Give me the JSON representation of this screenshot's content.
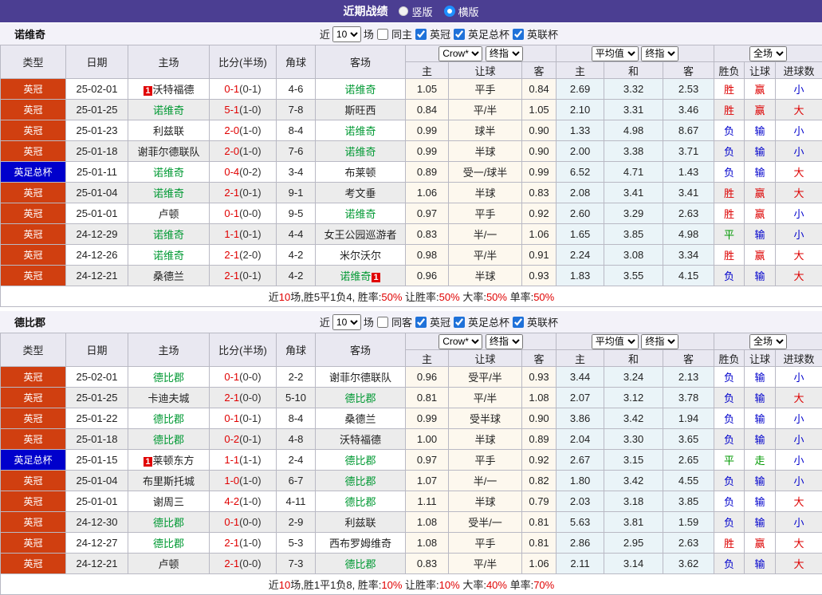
{
  "top_bar": {
    "title": "近期战绩",
    "radios": [
      {
        "label": "竖版",
        "selected": false
      },
      {
        "label": "横版",
        "selected": true
      }
    ]
  },
  "colors": {
    "topbar_purple": "#4b3e92",
    "league_orange": "#d03f10",
    "league_blue": "#0000cc",
    "win_red": "#dd0000",
    "lose_blue": "#0000cc",
    "draw_green": "#009900",
    "focal_team_green": "#009933",
    "score_red": "#e00000",
    "summary_red": "#e00000"
  },
  "columns": [
    "类型",
    "日期",
    "主场",
    "比分(半场)",
    "角球",
    "客场",
    "主",
    "让球",
    "客",
    "主",
    "和",
    "客",
    "胜负",
    "让球",
    "进球数"
  ],
  "selects": {
    "bookmaker": "Crow*",
    "stage1": "终指",
    "average": "平均值",
    "stage2": "终指",
    "scope": "全场"
  },
  "sections": [
    {
      "team": "诺维奇",
      "controls": {
        "recent_label": "近",
        "count": "10",
        "unit_label": "场",
        "same_venue_label": "同主",
        "same_venue_checked": false,
        "leagues": [
          {
            "label": "英冠",
            "checked": true
          },
          {
            "label": "英足总杯",
            "checked": true
          },
          {
            "label": "英联杯",
            "checked": true
          }
        ]
      },
      "rows": [
        {
          "league": "英冠",
          "league_color": "orange",
          "date": "25-02-01",
          "home": "沃特福德",
          "home_focal": false,
          "home_badge": "1",
          "home_badge_pos": "before",
          "away": "诺维奇",
          "away_focal": true,
          "away_badge": "",
          "away_badge_pos": "",
          "score": "0-1",
          "half": "(0-1)",
          "corner": "4-6",
          "ah": [
            "1.05",
            "平手",
            "0.84"
          ],
          "eu": [
            "2.69",
            "3.32",
            "2.53"
          ],
          "res": [
            [
              "胜",
              "r"
            ],
            [
              "赢",
              "r"
            ],
            [
              "小",
              "b"
            ]
          ]
        },
        {
          "league": "英冠",
          "league_color": "orange",
          "date": "25-01-25",
          "home": "诺维奇",
          "home_focal": true,
          "home_badge": "",
          "home_badge_pos": "",
          "away": "斯旺西",
          "away_focal": false,
          "away_badge": "",
          "away_badge_pos": "",
          "score": "5-1",
          "half": "(1-0)",
          "corner": "7-8",
          "ah": [
            "0.84",
            "平/半",
            "1.05"
          ],
          "eu": [
            "2.10",
            "3.31",
            "3.46"
          ],
          "res": [
            [
              "胜",
              "r"
            ],
            [
              "赢",
              "r"
            ],
            [
              "大",
              "r"
            ]
          ]
        },
        {
          "league": "英冠",
          "league_color": "orange",
          "date": "25-01-23",
          "home": "利兹联",
          "home_focal": false,
          "home_badge": "",
          "home_badge_pos": "",
          "away": "诺维奇",
          "away_focal": true,
          "away_badge": "",
          "away_badge_pos": "",
          "score": "2-0",
          "half": "(1-0)",
          "corner": "8-4",
          "ah": [
            "0.99",
            "球半",
            "0.90"
          ],
          "eu": [
            "1.33",
            "4.98",
            "8.67"
          ],
          "res": [
            [
              "负",
              "b"
            ],
            [
              "输",
              "b"
            ],
            [
              "小",
              "b"
            ]
          ]
        },
        {
          "league": "英冠",
          "league_color": "orange",
          "date": "25-01-18",
          "home": "谢菲尔德联队",
          "home_focal": false,
          "home_badge": "",
          "home_badge_pos": "",
          "away": "诺维奇",
          "away_focal": true,
          "away_badge": "",
          "away_badge_pos": "",
          "score": "2-0",
          "half": "(1-0)",
          "corner": "7-6",
          "ah": [
            "0.99",
            "半球",
            "0.90"
          ],
          "eu": [
            "2.00",
            "3.38",
            "3.71"
          ],
          "res": [
            [
              "负",
              "b"
            ],
            [
              "输",
              "b"
            ],
            [
              "小",
              "b"
            ]
          ]
        },
        {
          "league": "英足总杯",
          "league_color": "blue",
          "date": "25-01-11",
          "home": "诺维奇",
          "home_focal": true,
          "home_badge": "",
          "home_badge_pos": "",
          "away": "布莱顿",
          "away_focal": false,
          "away_badge": "",
          "away_badge_pos": "",
          "score": "0-4",
          "half": "(0-2)",
          "corner": "3-4",
          "ah": [
            "0.89",
            "受一/球半",
            "0.99"
          ],
          "eu": [
            "6.52",
            "4.71",
            "1.43"
          ],
          "res": [
            [
              "负",
              "b"
            ],
            [
              "输",
              "b"
            ],
            [
              "大",
              "r"
            ]
          ]
        },
        {
          "league": "英冠",
          "league_color": "orange",
          "date": "25-01-04",
          "home": "诺维奇",
          "home_focal": true,
          "home_badge": "",
          "home_badge_pos": "",
          "away": "考文垂",
          "away_focal": false,
          "away_badge": "",
          "away_badge_pos": "",
          "score": "2-1",
          "half": "(0-1)",
          "corner": "9-1",
          "ah": [
            "1.06",
            "半球",
            "0.83"
          ],
          "eu": [
            "2.08",
            "3.41",
            "3.41"
          ],
          "res": [
            [
              "胜",
              "r"
            ],
            [
              "赢",
              "r"
            ],
            [
              "大",
              "r"
            ]
          ]
        },
        {
          "league": "英冠",
          "league_color": "orange",
          "date": "25-01-01",
          "home": "卢顿",
          "home_focal": false,
          "home_badge": "",
          "home_badge_pos": "",
          "away": "诺维奇",
          "away_focal": true,
          "away_badge": "",
          "away_badge_pos": "",
          "score": "0-1",
          "half": "(0-0)",
          "corner": "9-5",
          "ah": [
            "0.97",
            "平手",
            "0.92"
          ],
          "eu": [
            "2.60",
            "3.29",
            "2.63"
          ],
          "res": [
            [
              "胜",
              "r"
            ],
            [
              "赢",
              "r"
            ],
            [
              "小",
              "b"
            ]
          ]
        },
        {
          "league": "英冠",
          "league_color": "orange",
          "date": "24-12-29",
          "home": "诺维奇",
          "home_focal": true,
          "home_badge": "",
          "home_badge_pos": "",
          "away": "女王公园巡游者",
          "away_focal": false,
          "away_badge": "",
          "away_badge_pos": "",
          "score": "1-1",
          "half": "(0-1)",
          "corner": "4-4",
          "ah": [
            "0.83",
            "半/一",
            "1.06"
          ],
          "eu": [
            "1.65",
            "3.85",
            "4.98"
          ],
          "res": [
            [
              "平",
              "g"
            ],
            [
              "输",
              "b"
            ],
            [
              "小",
              "b"
            ]
          ]
        },
        {
          "league": "英冠",
          "league_color": "orange",
          "date": "24-12-26",
          "home": "诺维奇",
          "home_focal": true,
          "home_badge": "",
          "home_badge_pos": "",
          "away": "米尔沃尔",
          "away_focal": false,
          "away_badge": "",
          "away_badge_pos": "",
          "score": "2-1",
          "half": "(2-0)",
          "corner": "4-2",
          "ah": [
            "0.98",
            "平/半",
            "0.91"
          ],
          "eu": [
            "2.24",
            "3.08",
            "3.34"
          ],
          "res": [
            [
              "胜",
              "r"
            ],
            [
              "赢",
              "r"
            ],
            [
              "大",
              "r"
            ]
          ]
        },
        {
          "league": "英冠",
          "league_color": "orange",
          "date": "24-12-21",
          "home": "桑德兰",
          "home_focal": false,
          "home_badge": "",
          "home_badge_pos": "",
          "away": "诺维奇",
          "away_focal": true,
          "away_badge": "1",
          "away_badge_pos": "after",
          "score": "2-1",
          "half": "(0-1)",
          "corner": "4-2",
          "ah": [
            "0.96",
            "半球",
            "0.93"
          ],
          "eu": [
            "1.83",
            "3.55",
            "4.15"
          ],
          "res": [
            [
              "负",
              "b"
            ],
            [
              "输",
              "b"
            ],
            [
              "大",
              "r"
            ]
          ]
        }
      ],
      "summary": [
        {
          "text": "近",
          "color": "dark"
        },
        {
          "text": "10",
          "color": "red"
        },
        {
          "text": "场,胜5平1负4, 胜率:",
          "color": "dark"
        },
        {
          "text": "50%",
          "color": "red"
        },
        {
          "text": " 让胜率:",
          "color": "dark"
        },
        {
          "text": "50%",
          "color": "red"
        },
        {
          "text": " 大率:",
          "color": "dark"
        },
        {
          "text": "50%",
          "color": "red"
        },
        {
          "text": " 单率:",
          "color": "dark"
        },
        {
          "text": "50%",
          "color": "red"
        }
      ]
    },
    {
      "team": "德比郡",
      "controls": {
        "recent_label": "近",
        "count": "10",
        "unit_label": "场",
        "same_venue_label": "同客",
        "same_venue_checked": false,
        "leagues": [
          {
            "label": "英冠",
            "checked": true
          },
          {
            "label": "英足总杯",
            "checked": true
          },
          {
            "label": "英联杯",
            "checked": true
          }
        ]
      },
      "rows": [
        {
          "league": "英冠",
          "league_color": "orange",
          "date": "25-02-01",
          "home": "德比郡",
          "home_focal": true,
          "home_badge": "",
          "home_badge_pos": "",
          "away": "谢菲尔德联队",
          "away_focal": false,
          "away_badge": "",
          "away_badge_pos": "",
          "score": "0-1",
          "half": "(0-0)",
          "corner": "2-2",
          "ah": [
            "0.96",
            "受平/半",
            "0.93"
          ],
          "eu": [
            "3.44",
            "3.24",
            "2.13"
          ],
          "res": [
            [
              "负",
              "b"
            ],
            [
              "输",
              "b"
            ],
            [
              "小",
              "b"
            ]
          ]
        },
        {
          "league": "英冠",
          "league_color": "orange",
          "date": "25-01-25",
          "home": "卡迪夫城",
          "home_focal": false,
          "home_badge": "",
          "home_badge_pos": "",
          "away": "德比郡",
          "away_focal": true,
          "away_badge": "",
          "away_badge_pos": "",
          "score": "2-1",
          "half": "(0-0)",
          "corner": "5-10",
          "ah": [
            "0.81",
            "平/半",
            "1.08"
          ],
          "eu": [
            "2.07",
            "3.12",
            "3.78"
          ],
          "res": [
            [
              "负",
              "b"
            ],
            [
              "输",
              "b"
            ],
            [
              "大",
              "r"
            ]
          ]
        },
        {
          "league": "英冠",
          "league_color": "orange",
          "date": "25-01-22",
          "home": "德比郡",
          "home_focal": true,
          "home_badge": "",
          "home_badge_pos": "",
          "away": "桑德兰",
          "away_focal": false,
          "away_badge": "",
          "away_badge_pos": "",
          "score": "0-1",
          "half": "(0-1)",
          "corner": "8-4",
          "ah": [
            "0.99",
            "受半球",
            "0.90"
          ],
          "eu": [
            "3.86",
            "3.42",
            "1.94"
          ],
          "res": [
            [
              "负",
              "b"
            ],
            [
              "输",
              "b"
            ],
            [
              "小",
              "b"
            ]
          ]
        },
        {
          "league": "英冠",
          "league_color": "orange",
          "date": "25-01-18",
          "home": "德比郡",
          "home_focal": true,
          "home_badge": "",
          "home_badge_pos": "",
          "away": "沃特福德",
          "away_focal": false,
          "away_badge": "",
          "away_badge_pos": "",
          "score": "0-2",
          "half": "(0-1)",
          "corner": "4-8",
          "ah": [
            "1.00",
            "半球",
            "0.89"
          ],
          "eu": [
            "2.04",
            "3.30",
            "3.65"
          ],
          "res": [
            [
              "负",
              "b"
            ],
            [
              "输",
              "b"
            ],
            [
              "小",
              "b"
            ]
          ]
        },
        {
          "league": "英足总杯",
          "league_color": "blue",
          "date": "25-01-15",
          "home": "莱顿东方",
          "home_focal": false,
          "home_badge": "1",
          "home_badge_pos": "before",
          "away": "德比郡",
          "away_focal": true,
          "away_badge": "",
          "away_badge_pos": "",
          "score": "1-1",
          "half": "(1-1)",
          "corner": "2-4",
          "ah": [
            "0.97",
            "平手",
            "0.92"
          ],
          "eu": [
            "2.67",
            "3.15",
            "2.65"
          ],
          "res": [
            [
              "平",
              "g"
            ],
            [
              "走",
              "g"
            ],
            [
              "小",
              "b"
            ]
          ]
        },
        {
          "league": "英冠",
          "league_color": "orange",
          "date": "25-01-04",
          "home": "布里斯托城",
          "home_focal": false,
          "home_badge": "",
          "home_badge_pos": "",
          "away": "德比郡",
          "away_focal": true,
          "away_badge": "",
          "away_badge_pos": "",
          "score": "1-0",
          "half": "(1-0)",
          "corner": "6-7",
          "ah": [
            "1.07",
            "半/一",
            "0.82"
          ],
          "eu": [
            "1.80",
            "3.42",
            "4.55"
          ],
          "res": [
            [
              "负",
              "b"
            ],
            [
              "输",
              "b"
            ],
            [
              "小",
              "b"
            ]
          ]
        },
        {
          "league": "英冠",
          "league_color": "orange",
          "date": "25-01-01",
          "home": "谢周三",
          "home_focal": false,
          "home_badge": "",
          "home_badge_pos": "",
          "away": "德比郡",
          "away_focal": true,
          "away_badge": "",
          "away_badge_pos": "",
          "score": "4-2",
          "half": "(1-0)",
          "corner": "4-11",
          "ah": [
            "1.11",
            "半球",
            "0.79"
          ],
          "eu": [
            "2.03",
            "3.18",
            "3.85"
          ],
          "res": [
            [
              "负",
              "b"
            ],
            [
              "输",
              "b"
            ],
            [
              "大",
              "r"
            ]
          ]
        },
        {
          "league": "英冠",
          "league_color": "orange",
          "date": "24-12-30",
          "home": "德比郡",
          "home_focal": true,
          "home_badge": "",
          "home_badge_pos": "",
          "away": "利兹联",
          "away_focal": false,
          "away_badge": "",
          "away_badge_pos": "",
          "score": "0-1",
          "half": "(0-0)",
          "corner": "2-9",
          "ah": [
            "1.08",
            "受半/一",
            "0.81"
          ],
          "eu": [
            "5.63",
            "3.81",
            "1.59"
          ],
          "res": [
            [
              "负",
              "b"
            ],
            [
              "输",
              "b"
            ],
            [
              "小",
              "b"
            ]
          ]
        },
        {
          "league": "英冠",
          "league_color": "orange",
          "date": "24-12-27",
          "home": "德比郡",
          "home_focal": true,
          "home_badge": "",
          "home_badge_pos": "",
          "away": "西布罗姆维奇",
          "away_focal": false,
          "away_badge": "",
          "away_badge_pos": "",
          "score": "2-1",
          "half": "(1-0)",
          "corner": "5-3",
          "ah": [
            "1.08",
            "平手",
            "0.81"
          ],
          "eu": [
            "2.86",
            "2.95",
            "2.63"
          ],
          "res": [
            [
              "胜",
              "r"
            ],
            [
              "赢",
              "r"
            ],
            [
              "大",
              "r"
            ]
          ]
        },
        {
          "league": "英冠",
          "league_color": "orange",
          "date": "24-12-21",
          "home": "卢顿",
          "home_focal": false,
          "home_badge": "",
          "home_badge_pos": "",
          "away": "德比郡",
          "away_focal": true,
          "away_badge": "",
          "away_badge_pos": "",
          "score": "2-1",
          "half": "(0-0)",
          "corner": "7-3",
          "ah": [
            "0.83",
            "平/半",
            "1.06"
          ],
          "eu": [
            "2.11",
            "3.14",
            "3.62"
          ],
          "res": [
            [
              "负",
              "b"
            ],
            [
              "输",
              "b"
            ],
            [
              "大",
              "r"
            ]
          ]
        }
      ],
      "summary": [
        {
          "text": "近",
          "color": "dark"
        },
        {
          "text": "10",
          "color": "red"
        },
        {
          "text": "场,胜1平1负8, 胜率:",
          "color": "dark"
        },
        {
          "text": "10%",
          "color": "red"
        },
        {
          "text": " 让胜率:",
          "color": "dark"
        },
        {
          "text": "10%",
          "color": "red"
        },
        {
          "text": " 大率:",
          "color": "dark"
        },
        {
          "text": "40%",
          "color": "red"
        },
        {
          "text": " 单率:",
          "color": "dark"
        },
        {
          "text": "70%",
          "color": "red"
        }
      ]
    }
  ]
}
